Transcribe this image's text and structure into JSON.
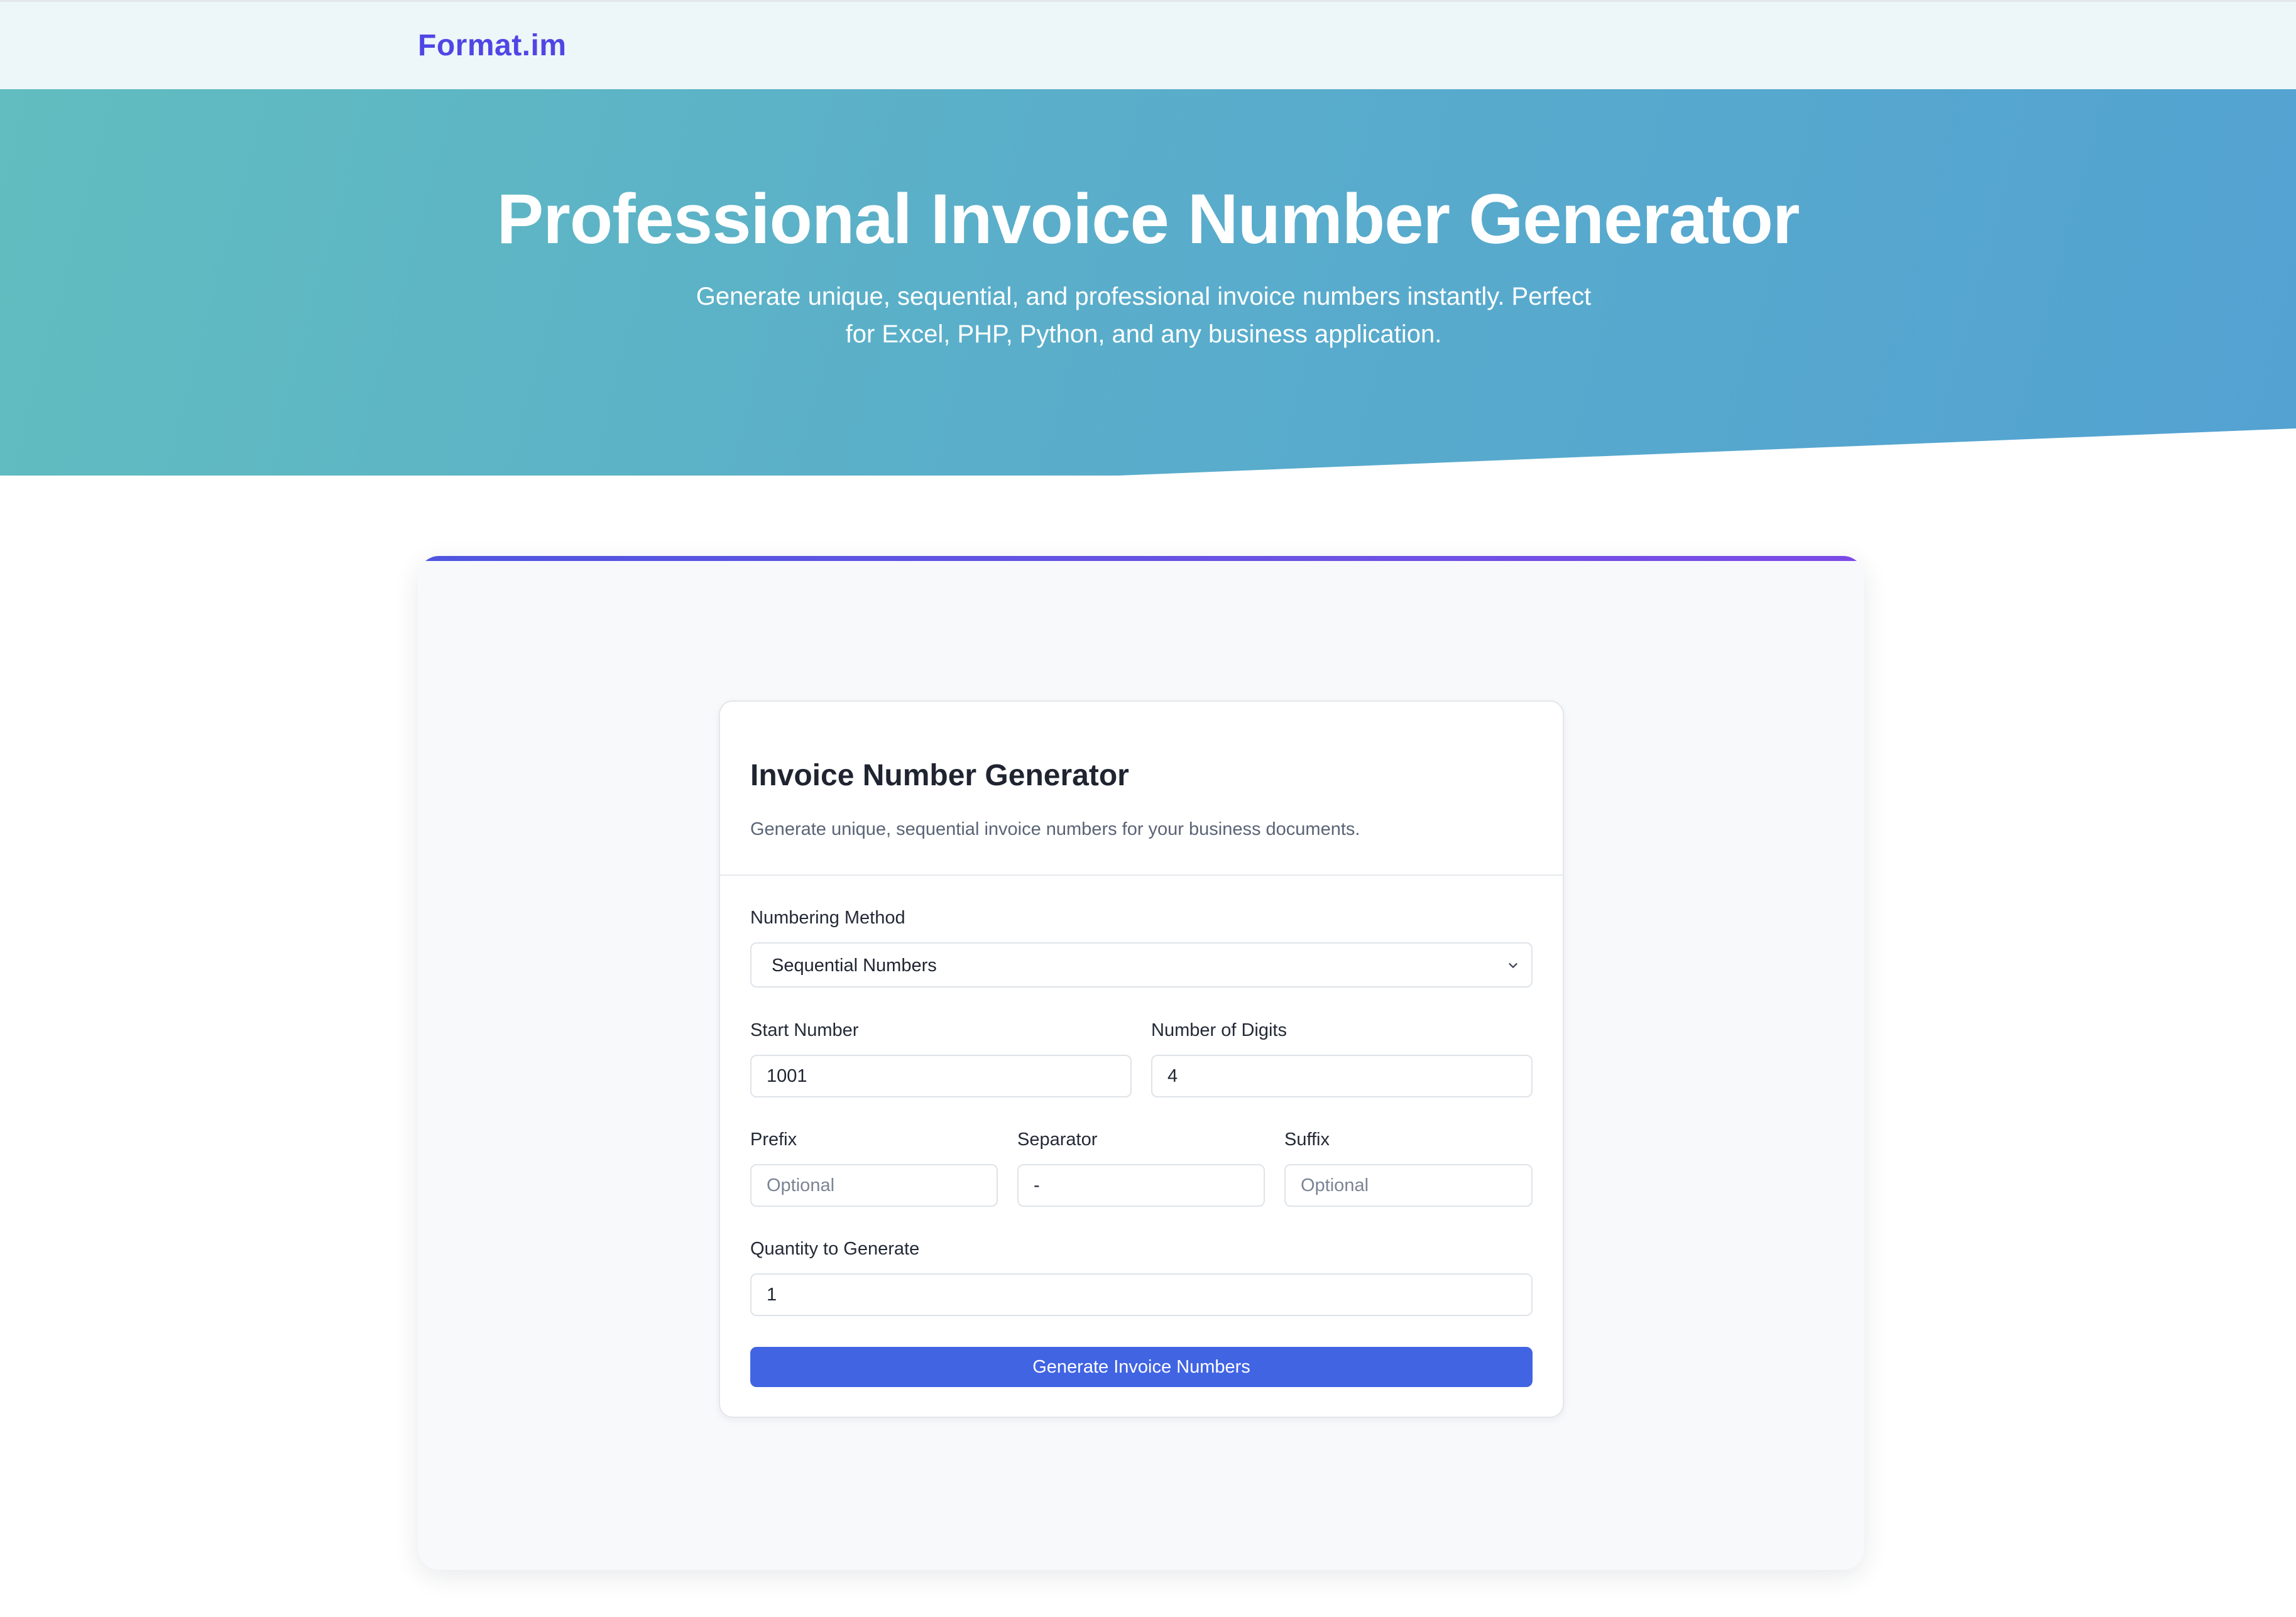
{
  "nav": {
    "logo": "Format.im"
  },
  "hero": {
    "title": "Professional Invoice Number Generator",
    "subtitle_line1": "Generate unique, sequential, and professional invoice numbers instantly. Perfect",
    "subtitle_line2": "for Excel, PHP, Python, and any business application."
  },
  "generator": {
    "title": "Invoice Number Generator",
    "description": "Generate unique, sequential invoice numbers for your business documents.",
    "numbering_method": {
      "label": "Numbering Method",
      "selected": "Sequential Numbers"
    },
    "start_number": {
      "label": "Start Number",
      "value": "1001"
    },
    "digits": {
      "label": "Number of Digits",
      "value": "4"
    },
    "prefix": {
      "label": "Prefix",
      "value": "",
      "placeholder": "Optional"
    },
    "separator": {
      "label": "Separator",
      "value": "-"
    },
    "suffix": {
      "label": "Suffix",
      "value": "",
      "placeholder": "Optional"
    },
    "quantity": {
      "label": "Quantity to Generate",
      "value": "1"
    },
    "button_label": "Generate Invoice Numbers"
  },
  "colors": {
    "brand": "#5046e5",
    "hero_gradient_start": "#61bdbf",
    "hero_gradient_end": "#53a2d2",
    "button": "#4164e3",
    "accent_bar": "#6a52e3"
  },
  "icons": {
    "select_chevron": "chevron-down-icon"
  }
}
